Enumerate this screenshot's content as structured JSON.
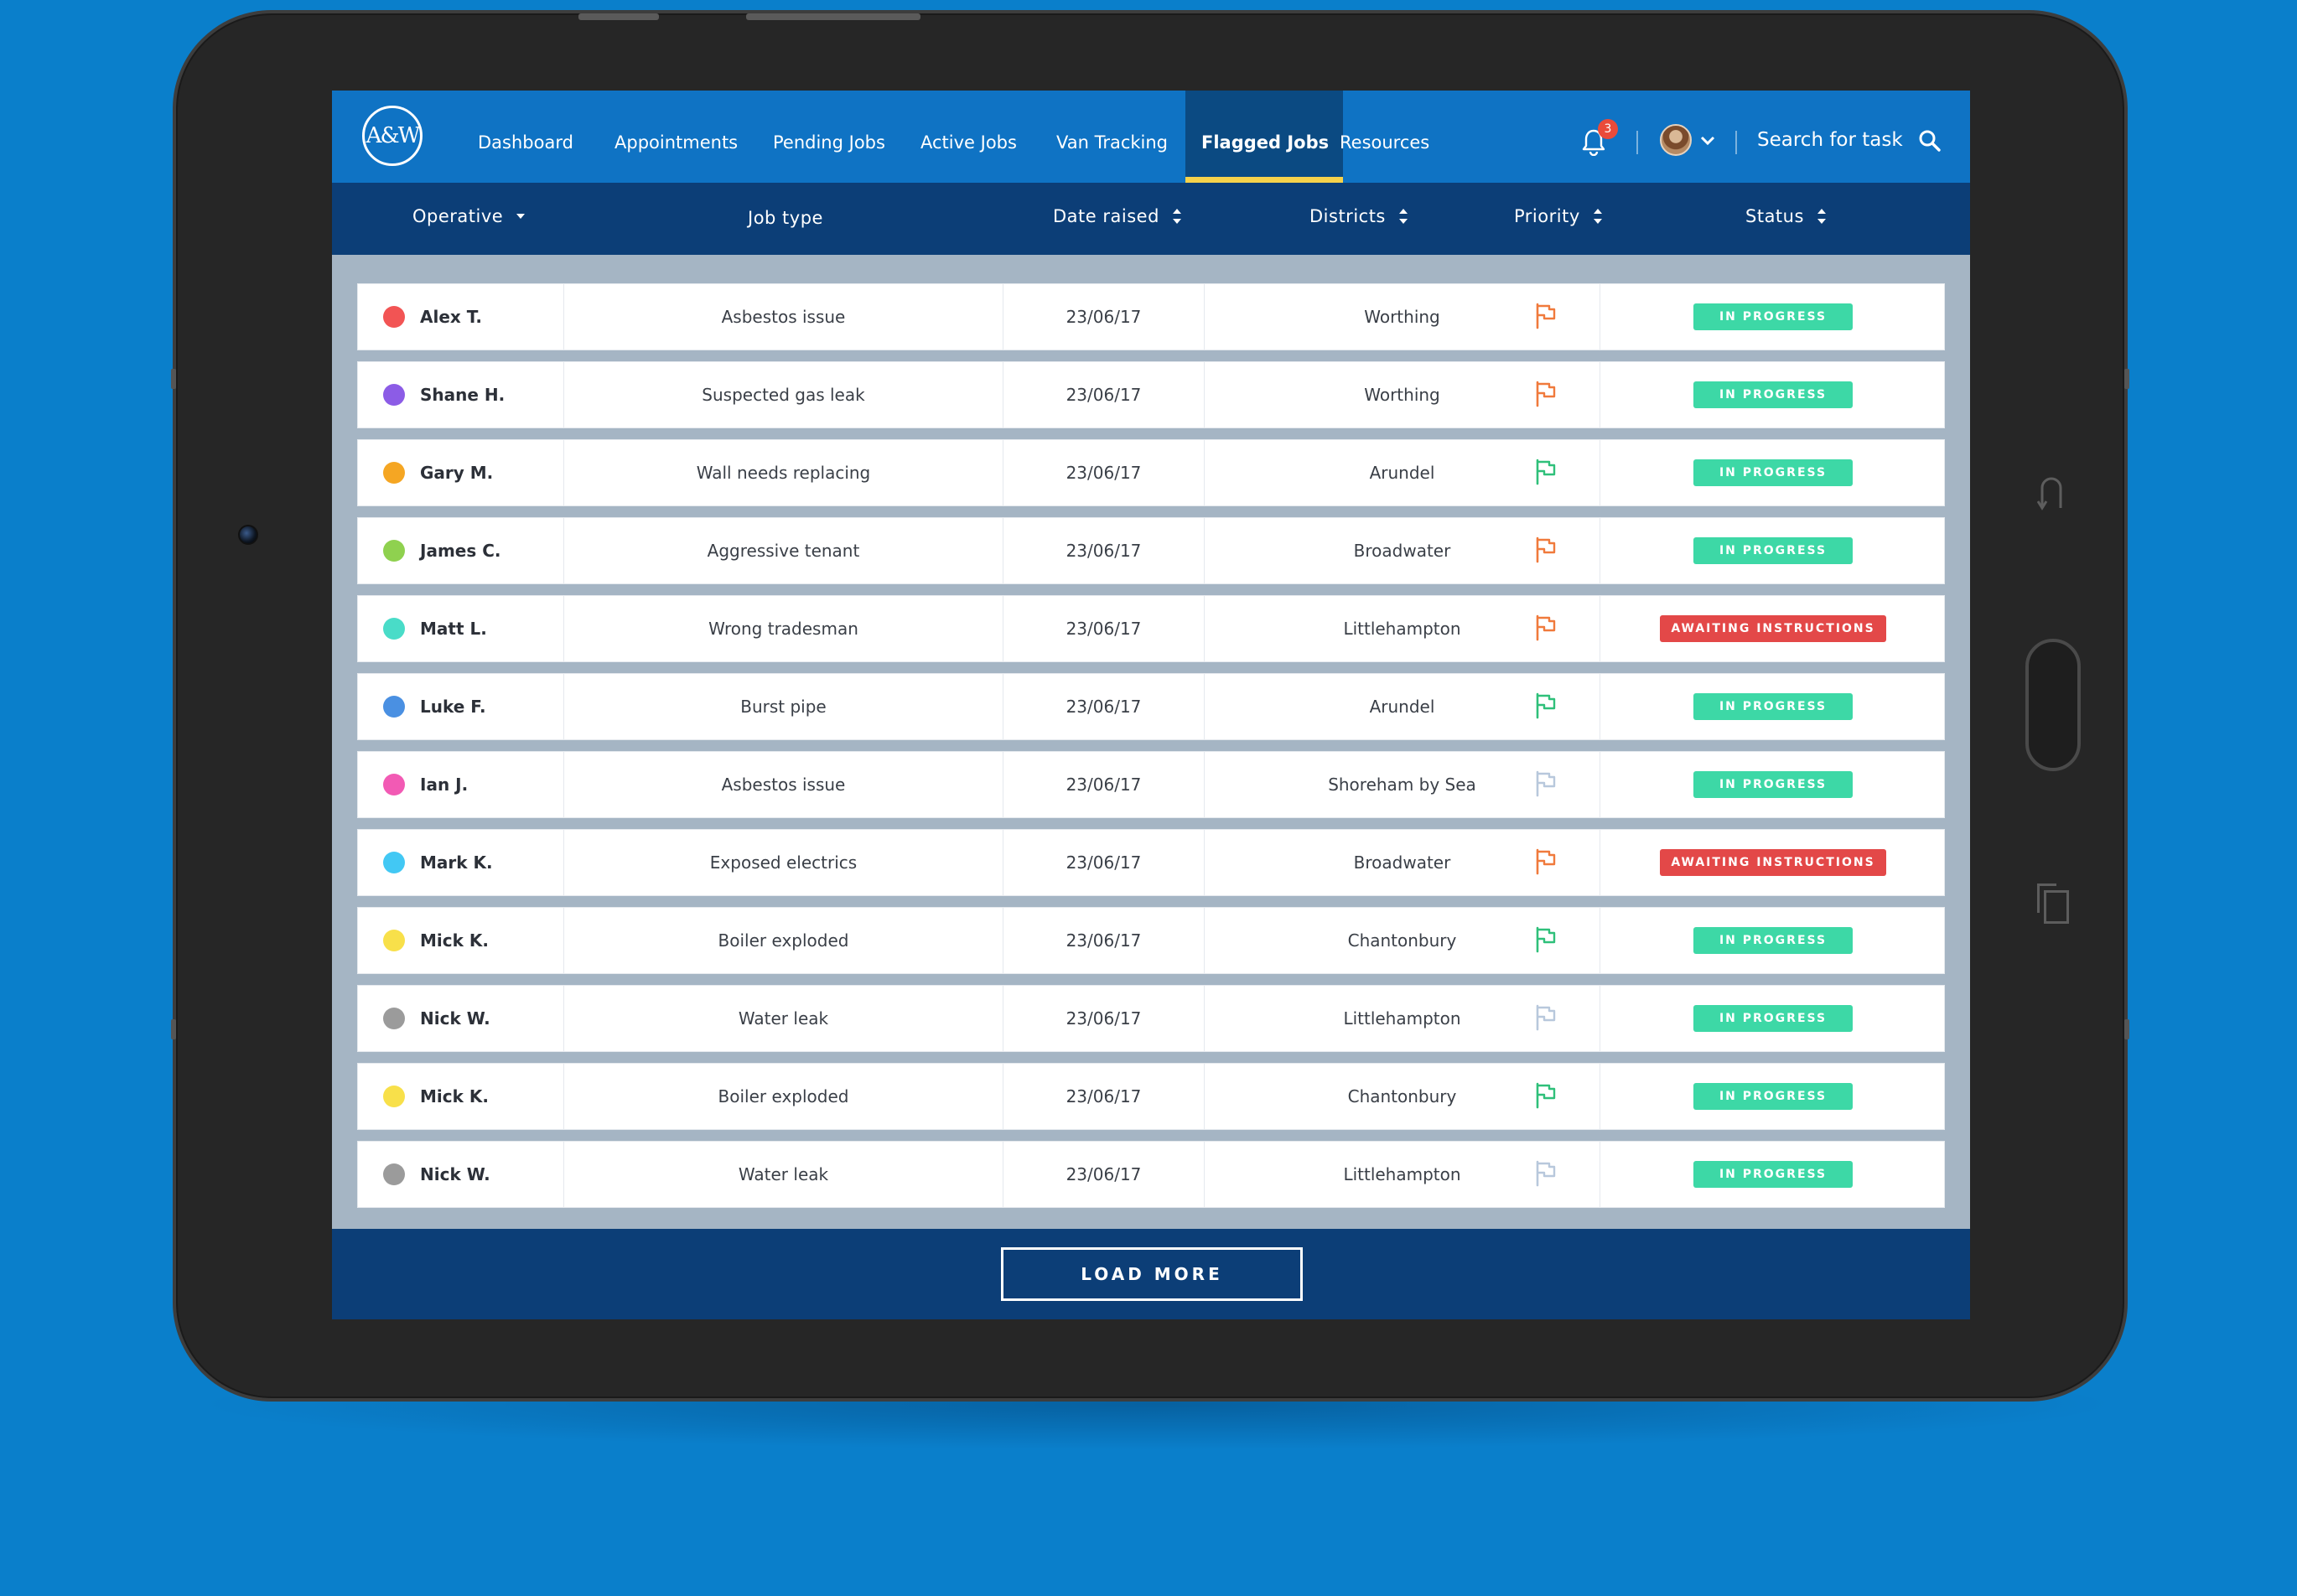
{
  "nav": {
    "logo": "A&W",
    "tabs": [
      {
        "label": "Dashboard"
      },
      {
        "label": "Appointments"
      },
      {
        "label": "Pending Jobs"
      },
      {
        "label": "Active Jobs"
      },
      {
        "label": "Van Tracking"
      },
      {
        "label": "Flagged Jobs",
        "active": true
      },
      {
        "label": "Resources"
      }
    ],
    "notifications_count": "3",
    "search_label": "Search for task"
  },
  "columns": {
    "operative": "Operative",
    "job_type": "Job type",
    "date_raised": "Date raised",
    "districts": "Districts",
    "priority": "Priority",
    "status": "Status"
  },
  "colors": {
    "nav_bg": "#0f73c4",
    "header_bg": "#0c3e77",
    "active_underline": "#f6d24b",
    "in_progress": "#3dd8a6",
    "awaiting": "#e34848",
    "flag_high": "#f07a3c",
    "flag_medium": "#2fc07a",
    "flag_low": "#b8c8dc"
  },
  "rows": [
    {
      "operative": "Alex T.",
      "dot": "#f25454",
      "job_type": "Asbestos issue",
      "date": "23/06/17",
      "district": "Worthing",
      "priority": "high",
      "status": "IN PROGRESS"
    },
    {
      "operative": "Shane H.",
      "dot": "#8c5ce6",
      "job_type": "Suspected gas leak",
      "date": "23/06/17",
      "district": "Worthing",
      "priority": "high",
      "status": "IN PROGRESS"
    },
    {
      "operative": "Gary M.",
      "dot": "#f5a623",
      "job_type": "Wall needs replacing",
      "date": "23/06/17",
      "district": "Arundel",
      "priority": "medium",
      "status": "IN PROGRESS"
    },
    {
      "operative": "James C.",
      "dot": "#8fd14f",
      "job_type": "Aggressive tenant",
      "date": "23/06/17",
      "district": "Broadwater",
      "priority": "high",
      "status": "IN PROGRESS"
    },
    {
      "operative": "Matt L.",
      "dot": "#49dcc8",
      "job_type": "Wrong tradesman",
      "date": "23/06/17",
      "district": "Littlehampton",
      "priority": "high",
      "status": "AWAITING INSTRUCTIONS"
    },
    {
      "operative": "Luke F.",
      "dot": "#4a90e2",
      "job_type": "Burst pipe",
      "date": "23/06/17",
      "district": "Arundel",
      "priority": "medium",
      "status": "IN PROGRESS"
    },
    {
      "operative": "Ian J.",
      "dot": "#f25ab4",
      "job_type": "Asbestos issue",
      "date": "23/06/17",
      "district": "Shoreham by Sea",
      "priority": "low",
      "status": "IN PROGRESS"
    },
    {
      "operative": "Mark K.",
      "dot": "#42c8f4",
      "job_type": "Exposed electrics",
      "date": "23/06/17",
      "district": "Broadwater",
      "priority": "high",
      "status": "AWAITING INSTRUCTIONS"
    },
    {
      "operative": "Mick K.",
      "dot": "#f8e04a",
      "job_type": "Boiler exploded",
      "date": "23/06/17",
      "district": "Chantonbury",
      "priority": "medium",
      "status": "IN PROGRESS"
    },
    {
      "operative": "Nick W.",
      "dot": "#9b9b9b",
      "job_type": "Water leak",
      "date": "23/06/17",
      "district": "Littlehampton",
      "priority": "low",
      "status": "IN PROGRESS"
    },
    {
      "operative": "Mick K.",
      "dot": "#f8e04a",
      "job_type": "Boiler exploded",
      "date": "23/06/17",
      "district": "Chantonbury",
      "priority": "medium",
      "status": "IN PROGRESS"
    },
    {
      "operative": "Nick W.",
      "dot": "#9b9b9b",
      "job_type": "Water leak",
      "date": "23/06/17",
      "district": "Littlehampton",
      "priority": "low",
      "status": "IN PROGRESS"
    }
  ],
  "footer": {
    "load_more": "LOAD MORE"
  }
}
